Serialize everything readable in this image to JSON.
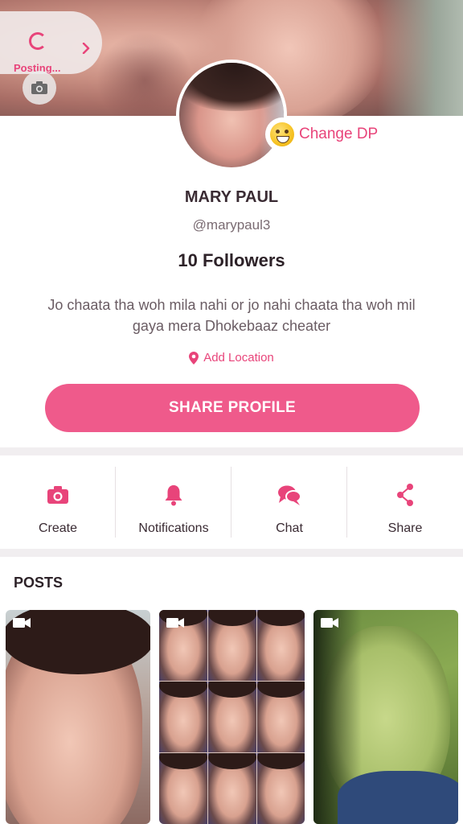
{
  "cover": {
    "posting_label": "Posting..."
  },
  "profile": {
    "change_dp_label": "Change DP",
    "name": "MARY PAUL",
    "handle": "@marypaul3",
    "followers": "10 Followers",
    "bio": "Jo chaata tha woh mila nahi or jo nahi chaata tha woh mil gaya mera Dhokebaaz cheater",
    "location_label": "Add Location",
    "share_label": "SHARE PROFILE"
  },
  "actions": [
    {
      "label": "Create",
      "icon": "camera-icon"
    },
    {
      "label": "Notifications",
      "icon": "bell-icon"
    },
    {
      "label": "Chat",
      "icon": "chat-bubbles-icon"
    },
    {
      "label": "Share",
      "icon": "share-icon"
    }
  ],
  "posts": {
    "title": "POSTS",
    "items": [
      {
        "type": "video",
        "icon": "video-icon"
      },
      {
        "type": "video",
        "icon": "video-icon"
      },
      {
        "type": "video",
        "icon": "video-icon"
      }
    ]
  },
  "colors": {
    "accent": "#e8447a",
    "button": "#ef5a8b"
  }
}
